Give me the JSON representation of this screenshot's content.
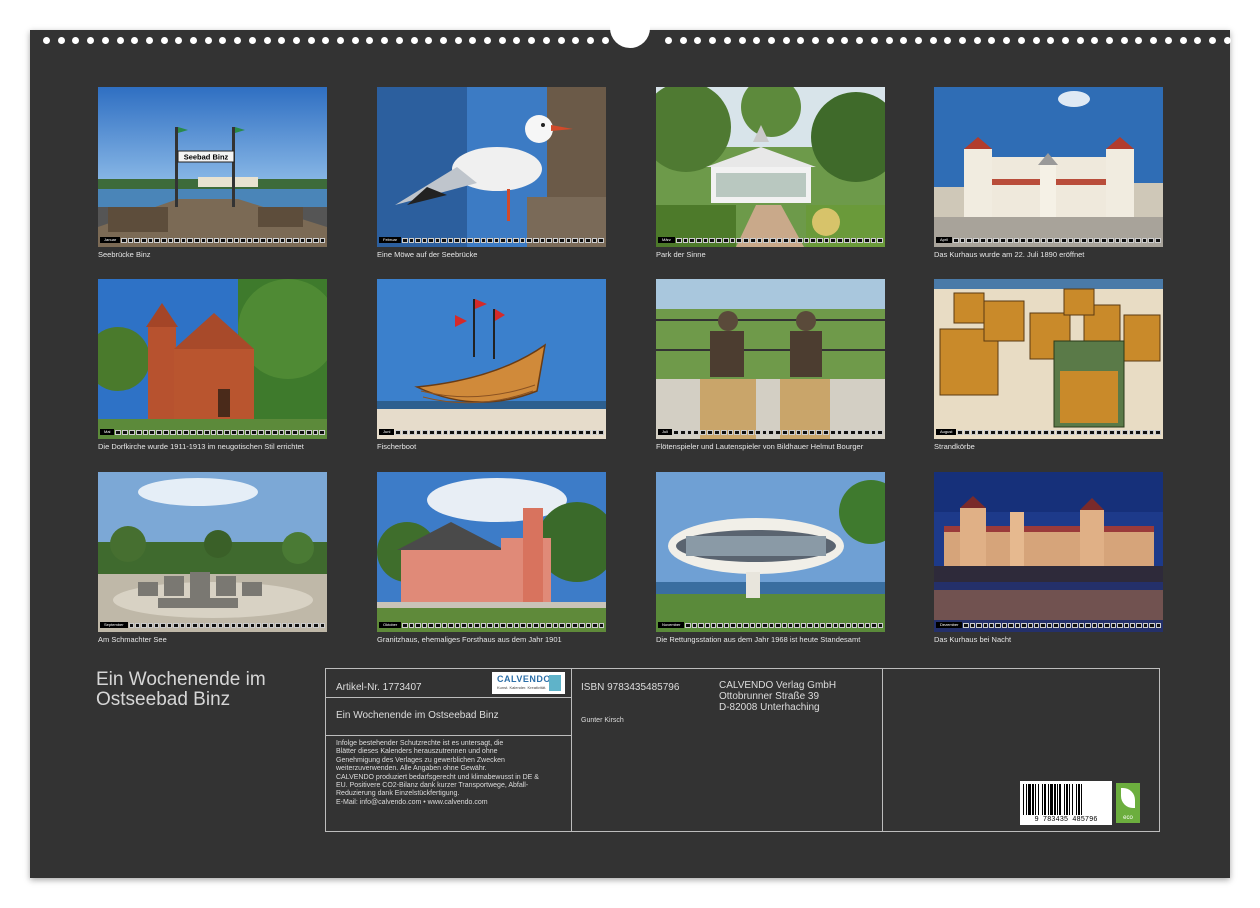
{
  "photos": [
    {
      "month": "Januar",
      "caption": "Seebrücke Binz",
      "sign": "Seebad Binz"
    },
    {
      "month": "Februar",
      "caption": "Eine Möwe auf der Seebrücke"
    },
    {
      "month": "März",
      "caption": "Park der Sinne"
    },
    {
      "month": "April",
      "caption": "Das Kurhaus wurde am 22. Juli 1890 eröffnet"
    },
    {
      "month": "Mai",
      "caption": "Die Dorfkirche wurde 1911-1913 im neugotischen Stil errichtet"
    },
    {
      "month": "Juni",
      "caption": "Fischerboot"
    },
    {
      "month": "Juli",
      "caption": "Flötenspieler und Lautenspieler von Bildhauer Helmut Bourger"
    },
    {
      "month": "August",
      "caption": "Strandkörbe"
    },
    {
      "month": "September",
      "caption": "Am Schmachter See"
    },
    {
      "month": "Oktober",
      "caption": "Granitzhaus, ehemaliges Forsthaus aus dem Jahr 1901"
    },
    {
      "month": "November",
      "caption": "Die Rettungsstation aus dem Jahr 1968 ist heute Standesamt"
    },
    {
      "month": "Dezember",
      "caption": "Das Kurhaus bei Nacht"
    }
  ],
  "calendar": {
    "title": "Ein Wochenende im Ostseebad Binz"
  },
  "info": {
    "article_label": "Artikel-Nr. 1773407",
    "logo_brand": "CALVENDO",
    "logo_tag": "Kunst. Kalender. Kreativität.",
    "calendar_name": "Ein Wochenende im Ostseebad Binz",
    "isbn": "ISBN 9783435485796",
    "author": "Gunter Kirsch",
    "publisher_lines": [
      "CALVENDO Verlag GmbH",
      "Ottobrunner Straße 39",
      "D-82008 Unterhaching"
    ],
    "legal_lines": [
      "Infolge bestehender Schutzrechte ist es untersagt, die",
      "Blätter dieses Kalenders herauszutrennen und ohne",
      "Genehmigung des Verlages zu gewerblichen Zwecken",
      "weiterzuverwenden. Alle Angaben ohne Gewähr.",
      "CALVENDO produziert bedarfsgerecht und klimabewusst in DE &",
      "EU. Positivere CO2-Bilanz dank kurzer Transportwege, Abfall-",
      "Reduzierung dank Einzelstückfertigung.",
      "E-Mail: info@calvendo.com • www.calvendo.com"
    ],
    "barcode_number": "9 783435 485796",
    "eco_label": "eco"
  },
  "colors": {
    "sheet": "#333333",
    "border": "#bdbdbd"
  }
}
